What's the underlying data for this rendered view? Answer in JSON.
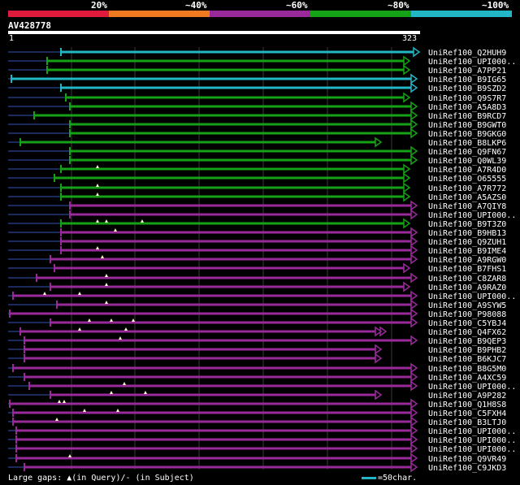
{
  "legend": {
    "labels": [
      "20%",
      "~40%",
      "~60%",
      "~80%",
      "~100%"
    ],
    "colors": [
      "#e01a3a",
      "#ef7a22",
      "#9a2a9a",
      "#16a216",
      "#22b6c6"
    ]
  },
  "query": {
    "name": "AV428778",
    "start": "1",
    "end": "323"
  },
  "hits": [
    {
      "name": "UniRef100_Q2HUH9",
      "color": "cyan",
      "qs": 75,
      "qe": 515,
      "ls": 10,
      "arrows": 1,
      "gaps": []
    },
    {
      "name": "UniRef100_UPI000..",
      "color": "green",
      "qs": 58,
      "qe": 503,
      "ls": 10,
      "arrows": 1,
      "gaps": []
    },
    {
      "name": "UniRef100_A7PP21",
      "color": "green",
      "qs": 58,
      "qe": 503,
      "ls": 10,
      "arrows": 1,
      "gaps": []
    },
    {
      "name": "UniRef100_B9IG65",
      "color": "cyan",
      "qs": 14,
      "qe": 512,
      "ls": 10,
      "arrows": 1,
      "gaps": []
    },
    {
      "name": "UniRef100_B9SZD2",
      "color": "cyan",
      "qs": 75,
      "qe": 512,
      "ls": 10,
      "arrows": 1,
      "gaps": []
    },
    {
      "name": "UniRef100_Q9S7R7",
      "color": "green",
      "qs": 81,
      "qe": 503,
      "ls": 10,
      "arrows": 1,
      "gaps": []
    },
    {
      "name": "UniRef100_A5A8D3",
      "color": "green",
      "qs": 86,
      "qe": 512,
      "ls": 10,
      "arrows": 1,
      "gaps": []
    },
    {
      "name": "UniRef100_B9RCD7",
      "color": "green",
      "qs": 42,
      "qe": 512,
      "ls": 10,
      "arrows": 1,
      "gaps": []
    },
    {
      "name": "UniRef100_B9GWT0",
      "color": "green",
      "qs": 86,
      "qe": 512,
      "ls": 10,
      "arrows": 1,
      "gaps": []
    },
    {
      "name": "UniRef100_B9GKG0",
      "color": "green",
      "qs": 86,
      "qe": 512,
      "ls": 10,
      "arrows": 1,
      "gaps": []
    },
    {
      "name": "UniRef100_B8LKP6",
      "color": "green",
      "qs": 25,
      "qe": 468,
      "ls": 10,
      "arrows": 1,
      "gaps": []
    },
    {
      "name": "UniRef100_Q9FN67",
      "color": "green",
      "qs": 86,
      "qe": 512,
      "ls": 10,
      "arrows": 1,
      "gaps": []
    },
    {
      "name": "UniRef100_Q0WL39",
      "color": "green",
      "qs": 86,
      "qe": 512,
      "ls": 10,
      "arrows": 1,
      "gaps": []
    },
    {
      "name": "UniRef100_A7R4D0",
      "color": "green",
      "qs": 75,
      "qe": 503,
      "ls": 10,
      "arrows": 1,
      "gaps": [
        120
      ]
    },
    {
      "name": "UniRef100_O65555",
      "color": "green",
      "qs": 67,
      "qe": 503,
      "ls": 10,
      "arrows": 1,
      "gaps": []
    },
    {
      "name": "UniRef100_A7R772",
      "color": "green",
      "qs": 75,
      "qe": 503,
      "ls": 10,
      "arrows": 1,
      "gaps": [
        120
      ]
    },
    {
      "name": "UniRef100_A5AZS0",
      "color": "green",
      "qs": 75,
      "qe": 503,
      "ls": 10,
      "arrows": 1,
      "gaps": [
        120
      ]
    },
    {
      "name": "UniRef100_A7QIY8",
      "color": "purple",
      "qs": 86,
      "qe": 512,
      "ls": 10,
      "arrows": 1,
      "gaps": []
    },
    {
      "name": "UniRef100_UPI000..",
      "color": "purple",
      "qs": 86,
      "qe": 512,
      "ls": 10,
      "arrows": 1,
      "gaps": []
    },
    {
      "name": "UniRef100_B9T3Z0",
      "color": "green",
      "qs": 75,
      "qe": 503,
      "ls": 10,
      "arrows": 1,
      "gaps": [
        120,
        131,
        175
      ]
    },
    {
      "name": "UniRef100_B9HB13",
      "color": "purple",
      "qs": 75,
      "qe": 512,
      "ls": 10,
      "arrows": 1,
      "gaps": [
        142
      ]
    },
    {
      "name": "UniRef100_Q9ZUH1",
      "color": "purple",
      "qs": 75,
      "qe": 512,
      "ls": 10,
      "arrows": 1,
      "gaps": []
    },
    {
      "name": "UniRef100_B9IME4",
      "color": "purple",
      "qs": 75,
      "qe": 512,
      "ls": 10,
      "arrows": 1,
      "gaps": [
        120
      ]
    },
    {
      "name": "UniRef100_A9RGW0",
      "color": "purple",
      "qs": 62,
      "qe": 512,
      "ls": 10,
      "arrows": 1,
      "gaps": [
        126
      ]
    },
    {
      "name": "UniRef100_B7FHS1",
      "color": "purple",
      "qs": 67,
      "qe": 503,
      "ls": 10,
      "arrows": 1,
      "gaps": []
    },
    {
      "name": "UniRef100_C8ZAR8",
      "color": "purple",
      "qs": 45,
      "qe": 512,
      "ls": 10,
      "arrows": 1,
      "gaps": [
        131
      ]
    },
    {
      "name": "UniRef100_A9RAZ0",
      "color": "purple",
      "qs": 62,
      "qe": 503,
      "ls": 10,
      "arrows": 1,
      "gaps": [
        131
      ]
    },
    {
      "name": "UniRef100_UPI000..",
      "color": "purple",
      "qs": 16,
      "qe": 512,
      "ls": 10,
      "arrows": 1,
      "gaps": [
        55,
        98
      ]
    },
    {
      "name": "UniRef100_A9SYW5",
      "color": "purple",
      "qs": 70,
      "qe": 512,
      "ls": 10,
      "arrows": 1,
      "gaps": [
        131
      ]
    },
    {
      "name": "UniRef100_P98088",
      "color": "purple",
      "qs": 12,
      "qe": 512,
      "ls": 10,
      "arrows": 1,
      "gaps": []
    },
    {
      "name": "UniRef100_C5YBJ4",
      "color": "purple",
      "qs": 62,
      "qe": 512,
      "ls": 10,
      "arrows": 1,
      "gaps": [
        110,
        137,
        164
      ]
    },
    {
      "name": "UniRef100_Q4FX62",
      "color": "purple",
      "qs": 25,
      "qe": 474,
      "ls": 10,
      "arrows": 2,
      "gaps": [
        98,
        155
      ]
    },
    {
      "name": "UniRef100_B9QEP3",
      "color": "purple",
      "qs": 30,
      "qe": 512,
      "ls": 10,
      "arrows": 1,
      "gaps": [
        148
      ]
    },
    {
      "name": "UniRef100_B9PHB2",
      "color": "purple",
      "qs": 30,
      "qe": 468,
      "ls": 10,
      "arrows": 1,
      "gaps": []
    },
    {
      "name": "UniRef100_B6KJC7",
      "color": "purple",
      "qs": 30,
      "qe": 468,
      "ls": 10,
      "arrows": 1,
      "gaps": []
    },
    {
      "name": "UniRef100_B8G5M0",
      "color": "purple",
      "qs": 16,
      "qe": 512,
      "ls": 10,
      "arrows": 1,
      "gaps": []
    },
    {
      "name": "UniRef100_A4XC59",
      "color": "purple",
      "qs": 30,
      "qe": 512,
      "ls": 10,
      "arrows": 1,
      "gaps": []
    },
    {
      "name": "UniRef100_UPI000..",
      "color": "purple",
      "qs": 36,
      "qe": 512,
      "ls": 10,
      "arrows": 1,
      "gaps": [
        153
      ]
    },
    {
      "name": "UniRef100_A9P282",
      "color": "purple",
      "qs": 62,
      "qe": 468,
      "ls": 10,
      "arrows": 1,
      "gaps": [
        137,
        179
      ]
    },
    {
      "name": "UniRef100_Q1H8S8",
      "color": "purple",
      "qs": 12,
      "qe": 512,
      "ls": 10,
      "arrows": 1,
      "gaps": [
        73,
        79
      ]
    },
    {
      "name": "UniRef100_C5FXH4",
      "color": "purple",
      "qs": 16,
      "qe": 512,
      "ls": 10,
      "arrows": 1,
      "gaps": [
        104,
        145
      ]
    },
    {
      "name": "UniRef100_B3LTJ0",
      "color": "purple",
      "qs": 16,
      "qe": 512,
      "ls": 10,
      "arrows": 1,
      "gaps": [
        70
      ]
    },
    {
      "name": "UniRef100_UPI000..",
      "color": "purple",
      "qs": 20,
      "qe": 512,
      "ls": 10,
      "arrows": 1,
      "gaps": []
    },
    {
      "name": "UniRef100_UPI000..",
      "color": "purple",
      "qs": 20,
      "qe": 512,
      "ls": 10,
      "arrows": 1,
      "gaps": []
    },
    {
      "name": "UniRef100_UPI000..",
      "color": "purple",
      "qs": 20,
      "qe": 512,
      "ls": 10,
      "arrows": 1,
      "gaps": []
    },
    {
      "name": "UniRef100_Q9VR49",
      "color": "purple",
      "qs": 20,
      "qe": 512,
      "ls": 10,
      "arrows": 1,
      "gaps": [
        86
      ]
    },
    {
      "name": "UniRef100_C9JKD3",
      "color": "purple",
      "qs": 30,
      "qe": 512,
      "ls": 10,
      "arrows": 1,
      "gaps": []
    }
  ],
  "footer": {
    "text": "Large gaps: ▲(in Query)/- (in Subject)",
    "scale": "=50char."
  }
}
